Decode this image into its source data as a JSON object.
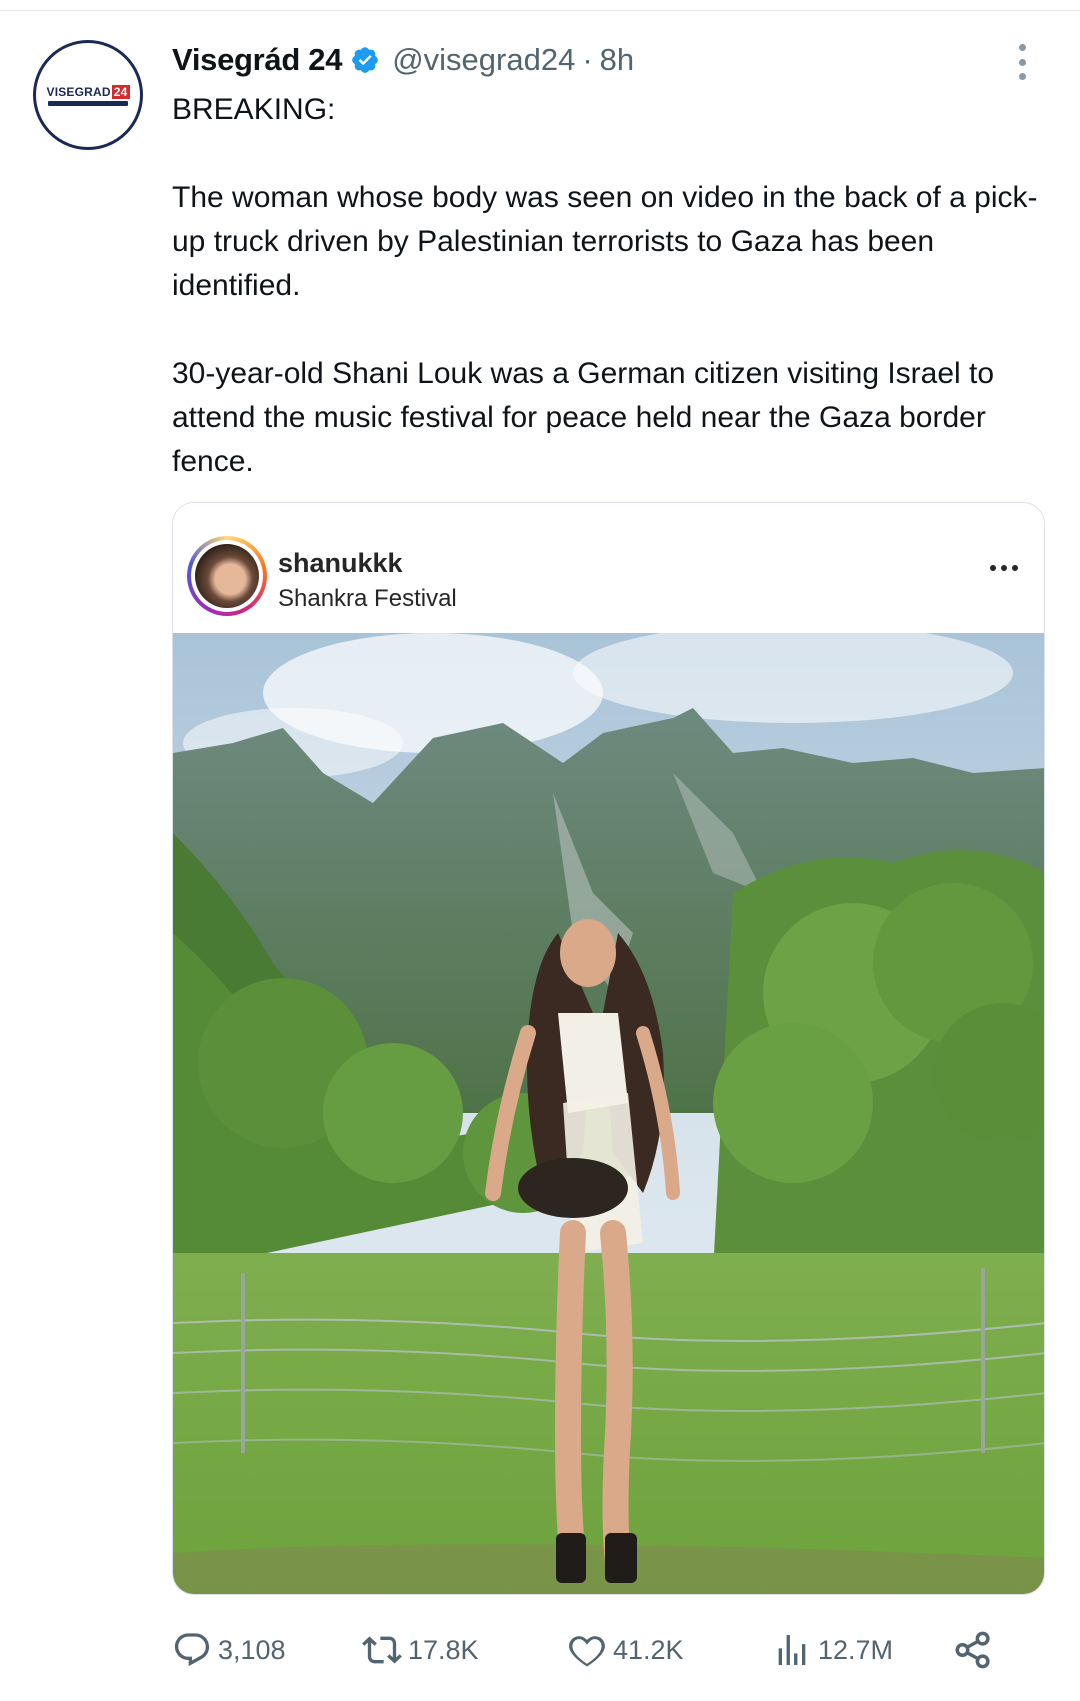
{
  "tweet": {
    "author": {
      "display_name": "Visegrád 24",
      "handle": "@visegrad24",
      "verified": true,
      "avatar_logo_text": "VISEGRAD",
      "avatar_logo_number": "24"
    },
    "separator": "·",
    "time": "8h",
    "text": {
      "line1": "BREAKING:",
      "para2": "The woman whose body was seen on video in the back of a pick-up truck driven by Palestinian terrorists to Gaza has been identified.",
      "para3": "30-year-old Shani Louk was a German citizen visiting Israel to attend the music festival for peace held near the Gaza border fence."
    }
  },
  "embed": {
    "username": "shanukkk",
    "location": "Shankra Festival",
    "more_icon": "more-horizontal-icon"
  },
  "actions": {
    "replies": "3,108",
    "reposts": "17.8K",
    "likes": "41.2K",
    "views": "12.7M"
  },
  "colors": {
    "text_primary": "#0f1419",
    "text_secondary": "#536471",
    "verified_blue": "#1d9bf0",
    "brand_navy": "#1a2a55",
    "brand_red": "#d52b2b"
  }
}
